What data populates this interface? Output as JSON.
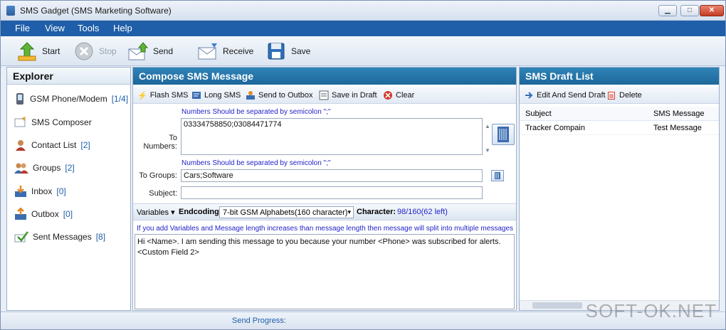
{
  "window": {
    "title": "SMS Gadget (SMS Marketing Software)",
    "min": "▁",
    "max": "□",
    "close": "✕"
  },
  "menu": [
    "File",
    "View",
    "Tools",
    "Help"
  ],
  "toolbar": {
    "start": "Start",
    "stop": "Stop",
    "send": "Send",
    "receive": "Receive",
    "save": "Save"
  },
  "explorer": {
    "title": "Explorer",
    "items": [
      {
        "label": "GSM Phone/Modem",
        "count": "[1/4]"
      },
      {
        "label": "SMS Composer",
        "count": ""
      },
      {
        "label": "Contact List",
        "count": "[2]"
      },
      {
        "label": "Groups",
        "count": "[2]"
      },
      {
        "label": "Inbox",
        "count": "[0]"
      },
      {
        "label": "Outbox",
        "count": "[0]"
      },
      {
        "label": "Sent Messages",
        "count": "[8]"
      }
    ]
  },
  "compose": {
    "title": "Compose SMS Message",
    "actions": {
      "flash": "Flash SMS",
      "long": "Long SMS",
      "outbox": "Send to Outbox",
      "draft": "Save in Draft",
      "clear": "Clear"
    },
    "numbers_hint": "Numbers Should be separated by semicolon \";\"",
    "groups_hint": "Numbers Should be separated by semicolon \";\"",
    "to_numbers_label": "To Numbers:",
    "to_numbers_value": "03334758850;03084471774",
    "to_groups_label": "To Groups:",
    "to_groups_value": "Cars;Software",
    "subject_label": "Subject:",
    "subject_value": "",
    "variables": "Variables",
    "encoding_label": "Endcoding:",
    "encoding_value": "7-bit GSM Alphabets(160 character)",
    "character_label": "Character:",
    "character_value": "98/160(62 left)",
    "split_note": "If you add Variables and Message length increases than message length then message will split into multiple messages",
    "message": "Hi <Name>. I am sending this message to you because your number <Phone> was subscribed for alerts. <Custom Field 2>"
  },
  "drafts": {
    "title": "SMS Draft List",
    "actions": {
      "edit_send": "Edit And Send Draft",
      "delete": "Delete"
    },
    "columns": [
      "Subject",
      "SMS Message"
    ],
    "rows": [
      {
        "subject": "Tracker Compain",
        "message": "Test Message"
      }
    ]
  },
  "status": {
    "progress_label": "Send Progress:"
  },
  "watermark": "SOFT-OK.NET",
  "colors": {
    "menubar": "#1f5ea8",
    "pane_header": "#1d679b",
    "hint": "#2323c9"
  }
}
